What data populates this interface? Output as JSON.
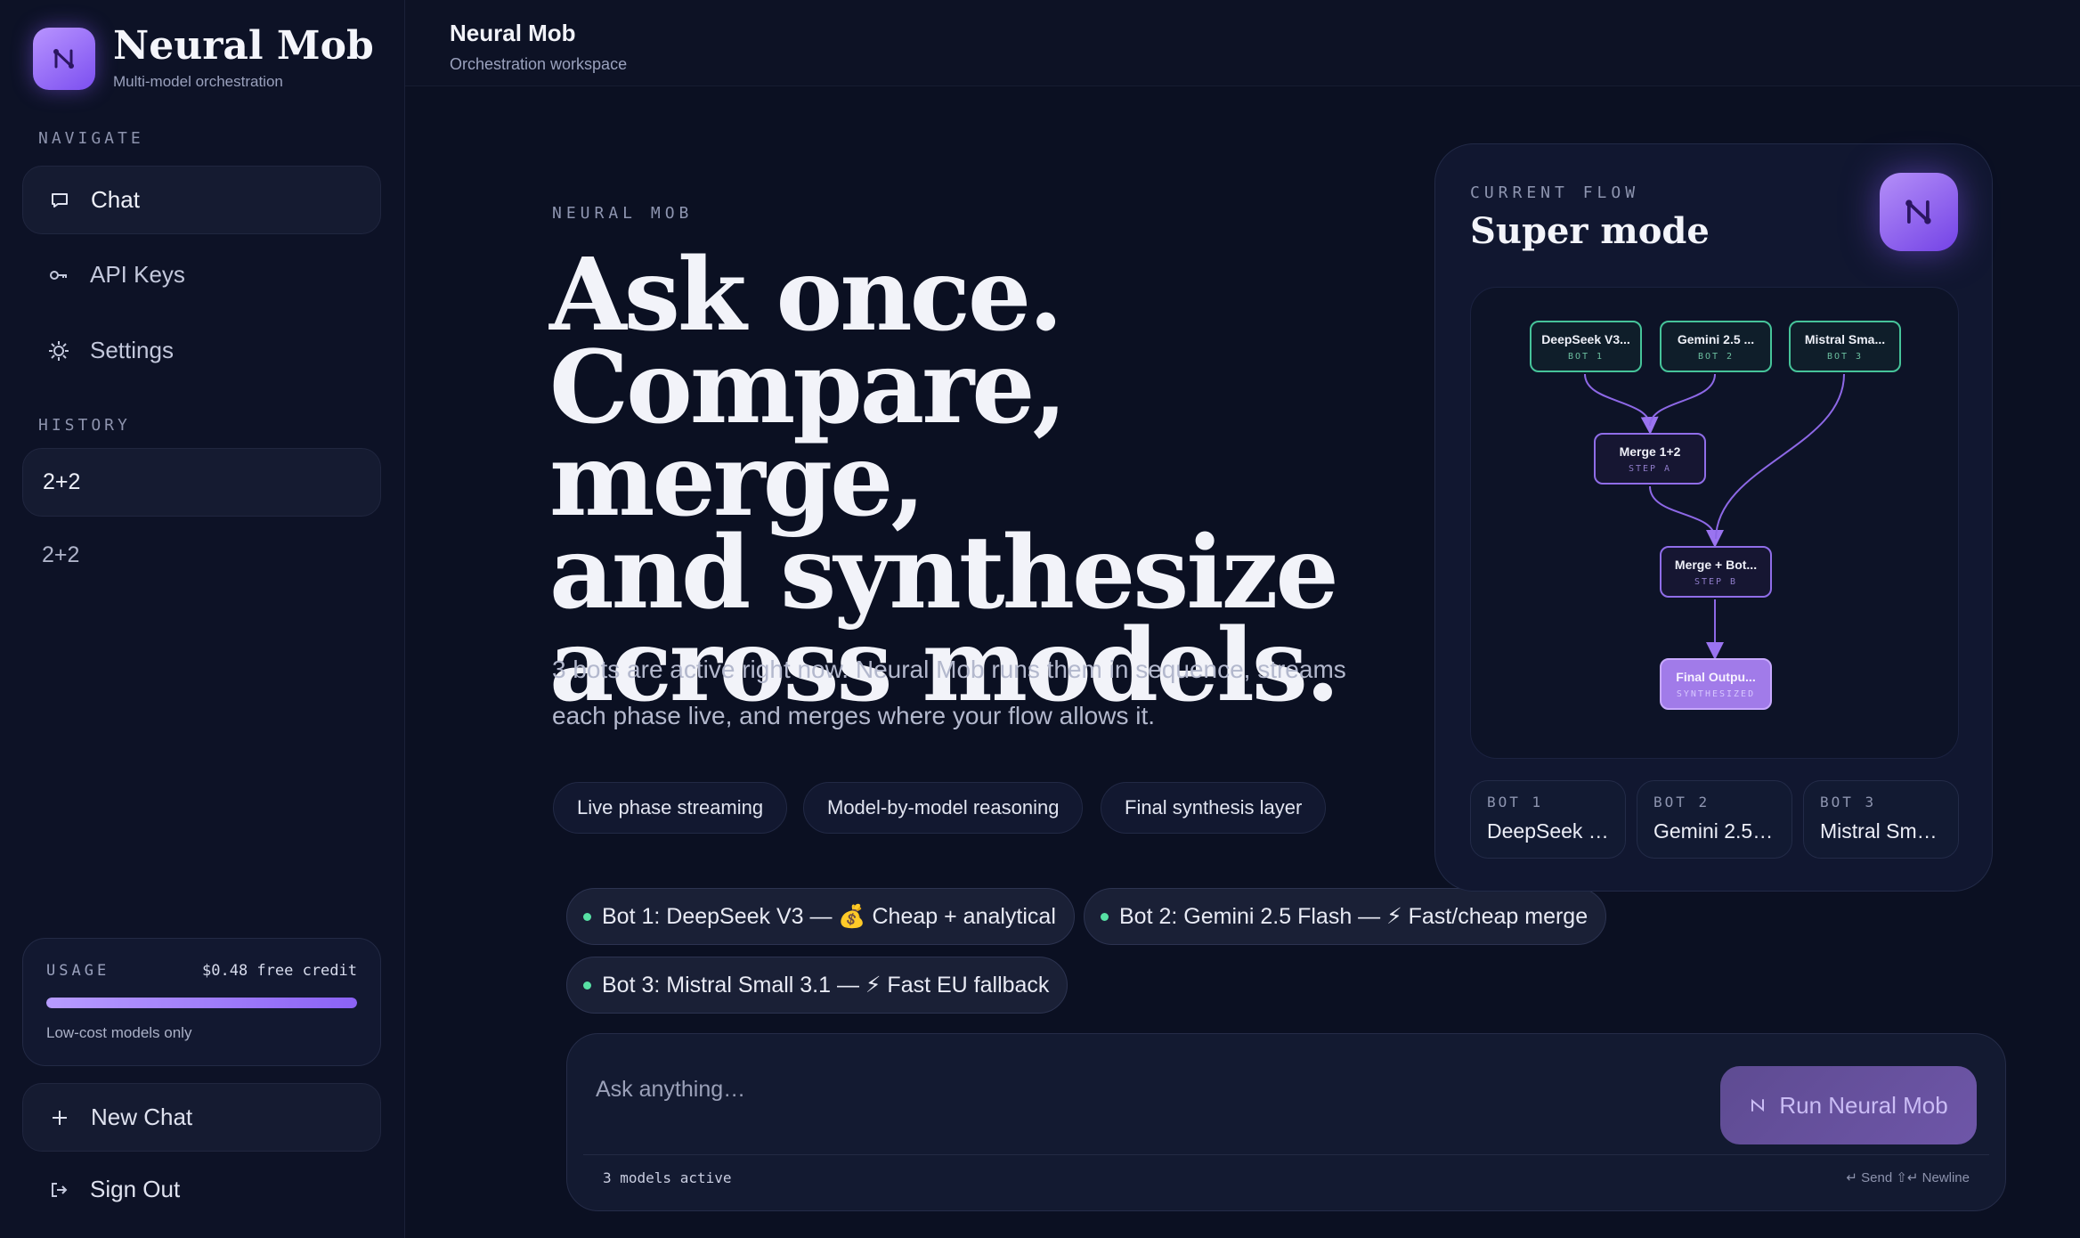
{
  "brand": {
    "title": "Neural Mob",
    "subtitle": "Multi-model orchestration"
  },
  "sidebar": {
    "navigate_label": "NAVIGATE",
    "nav": [
      {
        "label": "Chat",
        "icon": "chat-bubble-icon",
        "active": true
      },
      {
        "label": "API Keys",
        "icon": "key-icon"
      },
      {
        "label": "Settings",
        "icon": "gear-icon"
      }
    ],
    "history_label": "HISTORY",
    "history": [
      {
        "label": "2+2",
        "active": true
      },
      {
        "label": "2+2"
      }
    ],
    "usage": {
      "label": "USAGE",
      "credit": "$0.48 free credit",
      "note": "Low-cost models only",
      "fill": 1.0
    },
    "new_chat": "New Chat",
    "sign_out": "Sign Out"
  },
  "header": {
    "title": "Neural Mob",
    "subtitle": "Orchestration workspace"
  },
  "hero": {
    "eyebrow": "NEURAL MOB",
    "headline": [
      "Ask once.",
      "Compare, merge,",
      "and synthesize",
      "across models."
    ],
    "description": "3 bots are active right now. Neural Mob runs them in sequence, streams each phase live, and merges where your flow allows it.",
    "features": [
      "Live phase streaming",
      "Model-by-model reasoning",
      "Final synthesis layer"
    ]
  },
  "bots": [
    {
      "label": "Bot 1: DeepSeek V3 — 💰 Cheap + analytical"
    },
    {
      "label": "Bot 2: Gemini 2.5 Flash — ⚡ Fast/cheap merge"
    },
    {
      "label": "Bot 3: Mistral Small 3.1 — ⚡ Fast EU fallback"
    }
  ],
  "composer": {
    "placeholder": "Ask anything…",
    "run_label": "Run Neural Mob",
    "status": "3 models active",
    "hint": "↵ Send ⇧↵ Newline"
  },
  "flow": {
    "label": "CURRENT FLOW",
    "title": "Super mode",
    "nodes": [
      {
        "title": "DeepSeek V3...",
        "sub": "BOT 1"
      },
      {
        "title": "Gemini 2.5 ...",
        "sub": "BOT 2"
      },
      {
        "title": "Mistral Sma...",
        "sub": "BOT 3"
      },
      {
        "title": "Merge 1+2",
        "sub": "STEP A"
      },
      {
        "title": "Merge + Bot...",
        "sub": "STEP B"
      },
      {
        "title": "Final Outpu...",
        "sub": "SYNTHESIZED"
      }
    ],
    "tiles": [
      {
        "label": "BOT 1",
        "name": "DeepSeek …"
      },
      {
        "label": "BOT 2",
        "name": "Gemini 2.5…"
      },
      {
        "label": "BOT 3",
        "name": "Mistral Sm…"
      }
    ]
  },
  "colors": {
    "accent": "#8b62f5",
    "bot_node": "#46c49a",
    "status_dot": "#57e0a4",
    "background": "#0b1022"
  }
}
